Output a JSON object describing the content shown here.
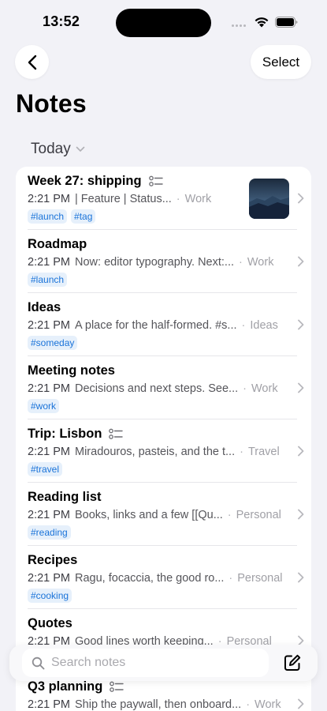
{
  "status_bar": {
    "time": "13:52"
  },
  "nav": {
    "select_label": "Select",
    "back_icon": "chevron-left-icon"
  },
  "page_title": "Notes",
  "section": {
    "label": "Today"
  },
  "notes": [
    {
      "title": "Week 27: shipping",
      "has_checklist": true,
      "time": "2:21 PM",
      "preview": "| Feature     | Status...",
      "folder": "Work",
      "tags": [
        "#launch",
        "#tag"
      ],
      "has_thumbnail": true
    },
    {
      "title": "Roadmap",
      "has_checklist": false,
      "time": "2:21 PM",
      "preview": "Now: editor typography. Next:...",
      "folder": "Work",
      "tags": [
        "#launch"
      ]
    },
    {
      "title": "Ideas",
      "has_checklist": false,
      "time": "2:21 PM",
      "preview": "A place for the half-formed. #s...",
      "folder": "Ideas",
      "tags": [
        "#someday"
      ]
    },
    {
      "title": "Meeting notes",
      "has_checklist": false,
      "time": "2:21 PM",
      "preview": "Decisions and next steps. See...",
      "folder": "Work",
      "tags": [
        "#work"
      ]
    },
    {
      "title": "Trip: Lisbon",
      "has_checklist": true,
      "time": "2:21 PM",
      "preview": "Miradouros, pasteis, and the t...",
      "folder": "Travel",
      "tags": [
        "#travel"
      ]
    },
    {
      "title": "Reading list",
      "has_checklist": false,
      "time": "2:21 PM",
      "preview": "Books, links and a few [[Qu...",
      "folder": "Personal",
      "tags": [
        "#reading"
      ]
    },
    {
      "title": "Recipes",
      "has_checklist": false,
      "time": "2:21 PM",
      "preview": "Ragu, focaccia, the good ro...",
      "folder": "Personal",
      "tags": [
        "#cooking"
      ]
    },
    {
      "title": "Quotes",
      "has_checklist": false,
      "time": "2:21 PM",
      "preview": "Good lines worth keeping...",
      "folder": "Personal",
      "tags": []
    },
    {
      "title": "Q3 planning",
      "has_checklist": true,
      "time": "2:21 PM",
      "preview": "Ship the paywall, then onboard...",
      "folder": "Work",
      "tags": []
    }
  ],
  "search": {
    "placeholder": "Search notes"
  },
  "colors": {
    "background": "#f2f2f7",
    "tag_text": "#1a73d9",
    "tag_bg": "#e6f0fb"
  }
}
